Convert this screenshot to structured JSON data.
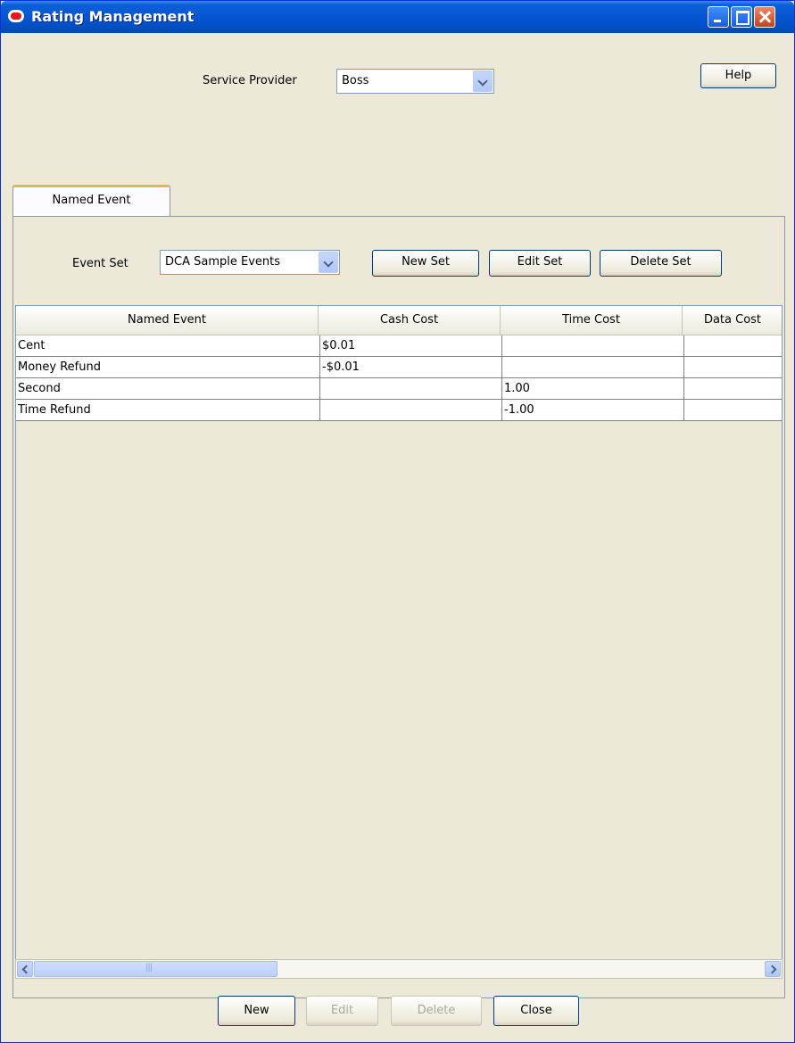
{
  "window": {
    "title": "Rating Management"
  },
  "header": {
    "service_provider_label": "Service Provider",
    "service_provider_value": "Boss",
    "help_label": "Help"
  },
  "tabs": [
    {
      "label": "Named Event"
    }
  ],
  "event_set": {
    "label": "Event Set",
    "value": "DCA Sample Events",
    "new_set_label": "New Set",
    "edit_set_label": "Edit Set",
    "delete_set_label": "Delete Set"
  },
  "table": {
    "columns": [
      "Named Event",
      "Cash Cost",
      "Time Cost",
      "Data Cost"
    ],
    "rows": [
      [
        "Cent",
        "$0.01",
        "",
        ""
      ],
      [
        "Money Refund",
        "-$0.01",
        "",
        ""
      ],
      [
        "Second",
        "",
        "1.00",
        ""
      ],
      [
        "Time Refund",
        "",
        "-1.00",
        ""
      ]
    ]
  },
  "footer": {
    "new_label": "New",
    "edit_label": "Edit",
    "delete_label": "Delete",
    "close_label": "Close"
  }
}
